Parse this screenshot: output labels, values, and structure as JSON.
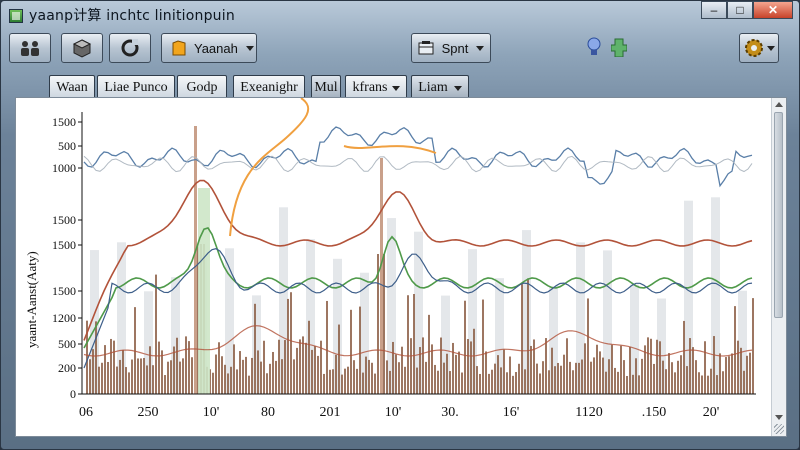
{
  "window": {
    "title": "yaanp计算 inchtc linitionpuin"
  },
  "caption_buttons": {
    "minimize": "–",
    "maximize": "□",
    "close": "✕"
  },
  "toolbar": {
    "dropdown_label": "Yaanah",
    "split_label": "Spnt"
  },
  "subbar": {
    "items": [
      {
        "label": "Waan"
      },
      {
        "label": "Liae Punco"
      },
      {
        "label": "Godp"
      },
      {
        "label": "Exeanighr"
      },
      {
        "label": "Mul"
      },
      {
        "label": "kfrans"
      },
      {
        "label": "Liam"
      }
    ]
  },
  "chart_data": {
    "type": "line",
    "ylabel": "yaant-Aanst(Aaty)",
    "y_ticks": [
      "1500",
      "500",
      "1000",
      "1500",
      "1500",
      "1500",
      "1200",
      "500",
      "200",
      "0"
    ],
    "x_ticks": [
      "06",
      "250",
      "10'",
      "80",
      "201",
      "10'",
      "30.",
      "16'",
      "1120",
      ".150",
      "20'"
    ],
    "series_colors": {
      "blue": "#5a7fa8",
      "grey": "#a9b3bd",
      "red": "#b2533a",
      "green": "#4f9a4a",
      "navy": "#3e5f8a",
      "brown": "#8c5e45",
      "orange": "#f0a040"
    }
  }
}
